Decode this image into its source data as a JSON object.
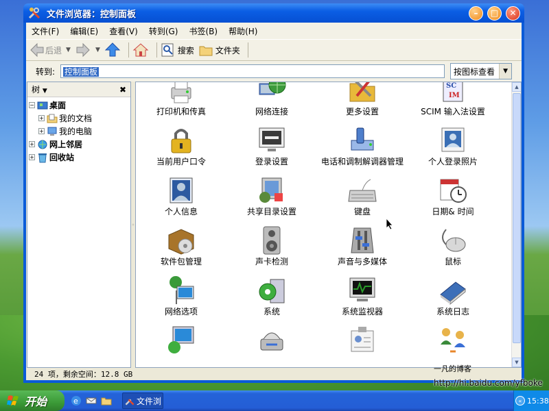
{
  "window": {
    "title": "文件浏览器：控制面板",
    "min_label": "–",
    "max_label": "□",
    "close_label": "✕"
  },
  "menubar": {
    "items": [
      {
        "label": "文件(F)"
      },
      {
        "label": "编辑(E)"
      },
      {
        "label": "查看(V)"
      },
      {
        "label": "转到(G)"
      },
      {
        "label": "书签(B)"
      },
      {
        "label": "帮助(H)"
      }
    ]
  },
  "toolbar": {
    "back_label": "后退",
    "search_label": "搜索",
    "folders_label": "文件夹"
  },
  "addressbar": {
    "label": "转到:",
    "value": "控制面板",
    "view_select": "按图标查看"
  },
  "sidebar": {
    "header": "树",
    "close": "✖",
    "items": [
      {
        "label": "桌面",
        "bold": true,
        "indent": 0,
        "exp": "−"
      },
      {
        "label": "我的文档",
        "bold": false,
        "indent": 1,
        "exp": "+"
      },
      {
        "label": "我的电脑",
        "bold": false,
        "indent": 1,
        "exp": "+"
      },
      {
        "label": "网上邻居",
        "bold": true,
        "indent": 0,
        "exp": "+"
      },
      {
        "label": "回收站",
        "bold": true,
        "indent": 0,
        "exp": "+"
      }
    ]
  },
  "icons": [
    {
      "label": "打印机和传真",
      "icon": "printer-icon",
      "color": "#9a9a9a"
    },
    {
      "label": "网络连接",
      "icon": "network-globe-icon",
      "color": "#3c9a3c"
    },
    {
      "label": "更多设置",
      "icon": "tools-folder-icon",
      "color": "#e8b93a"
    },
    {
      "label": "SCIM 输入法设置",
      "icon": "scim-icon",
      "color": "#2a4ea8"
    },
    {
      "label": "当前用户口令",
      "icon": "padlock-icon",
      "color": "#e3b320"
    },
    {
      "label": "登录设置",
      "icon": "login-monitor-icon",
      "color": "#3a3a3a"
    },
    {
      "label": "电话和调制解调器管理",
      "icon": "phone-modem-icon",
      "color": "#4e7fcc"
    },
    {
      "label": "个人登录照片",
      "icon": "photo-icon",
      "color": "#3a6fb5"
    },
    {
      "label": "个人信息",
      "icon": "personal-info-icon",
      "color": "#2d5aa0"
    },
    {
      "label": "共享目录设置",
      "icon": "shared-folder-icon",
      "color": "#5a8a3a"
    },
    {
      "label": "键盘",
      "icon": "keyboard-icon",
      "color": "#d0d0d0"
    },
    {
      "label": "日期& 时间",
      "icon": "calendar-clock-icon",
      "color": "#c33"
    },
    {
      "label": "软件包管理",
      "icon": "package-icon",
      "color": "#a8742a"
    },
    {
      "label": "声卡检测",
      "icon": "speaker-icon",
      "color": "#bbbbbb"
    },
    {
      "label": "声音与多媒体",
      "icon": "mixer-icon",
      "color": "#aaaaaa"
    },
    {
      "label": "鼠标",
      "icon": "mouse-icon",
      "color": "#d8d8d8"
    },
    {
      "label": "网络选项",
      "icon": "network-options-icon",
      "color": "#2a8ad8"
    },
    {
      "label": "系统",
      "icon": "system-gear-icon",
      "color": "#3fae3f"
    },
    {
      "label": "系统监视器",
      "icon": "system-monitor-icon",
      "color": "#2a9a2a"
    },
    {
      "label": "系统日志",
      "icon": "log-book-icon",
      "color": "#3d6fb8"
    },
    {
      "label": "",
      "icon": "display-settings-icon",
      "color": "#2a8ad8"
    },
    {
      "label": "",
      "icon": "scanner-icon",
      "color": "#555"
    },
    {
      "label": "",
      "icon": "id-card-icon",
      "color": "#888"
    },
    {
      "label": "",
      "icon": "users-icon",
      "color": "#3a8a3a"
    }
  ],
  "statusbar": {
    "text": "24 项，剩余空间：12.8 GB"
  },
  "taskbar": {
    "start_label": "开始",
    "task_label": "文件浏",
    "clock": "15:38"
  },
  "watermark": {
    "line1": "一凡的博客",
    "line2": "http://hi.baidu.com/yfboke"
  }
}
